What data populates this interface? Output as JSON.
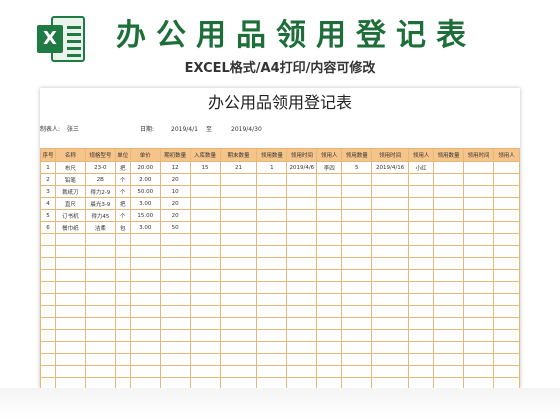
{
  "header": {
    "title": "办公用品领用登记表",
    "subtitle": "EXCEL格式/A4打印/内容可修改"
  },
  "form": {
    "title": "办公用品领用登记表",
    "filler_label": "制表人:",
    "filler_value": "张三",
    "date_label": "日期:",
    "date_from": "2019/4/1",
    "date_sep": "至",
    "date_to": "2019/4/30"
  },
  "columns": [
    "序号",
    "名称",
    "规格型号",
    "单位",
    "单价",
    "期初数量",
    "入库数量",
    "期末数量",
    "领用数量",
    "领用时间",
    "领用人",
    "领用数量",
    "领用时间",
    "领用人",
    "领用数量",
    "领用时间",
    "领用人"
  ],
  "rows": [
    [
      "1",
      "布尺",
      "23-0",
      "把",
      "20.00",
      "12",
      "15",
      "21",
      "1",
      "2019/4/6",
      "李四",
      "5",
      "2019/4/16",
      "小红",
      "",
      "",
      ""
    ],
    [
      "2",
      "铅笔",
      "2B",
      "个",
      "2.00",
      "20",
      "",
      "",
      "",
      "",
      "",
      "",
      "",
      "",
      "",
      "",
      ""
    ],
    [
      "3",
      "裁纸刀",
      "得力2-9",
      "个",
      "50.00",
      "10",
      "",
      "",
      "",
      "",
      "",
      "",
      "",
      "",
      "",
      "",
      ""
    ],
    [
      "4",
      "直尺",
      "晨光3-9",
      "把",
      "3.00",
      "20",
      "",
      "",
      "",
      "",
      "",
      "",
      "",
      "",
      "",
      "",
      ""
    ],
    [
      "5",
      "订书机",
      "得力45",
      "个",
      "15.00",
      "20",
      "",
      "",
      "",
      "",
      "",
      "",
      "",
      "",
      "",
      "",
      ""
    ],
    [
      "6",
      "餐巾纸",
      "洁柔",
      "包",
      "3.00",
      "50",
      "",
      "",
      "",
      "",
      "",
      "",
      "",
      "",
      "",
      "",
      ""
    ]
  ],
  "empty_rows": 15,
  "colors": {
    "brand_green": "#1e6e3a",
    "header_orange": "#f6c48a",
    "grid_border": "#e2b978",
    "divider_pink": "#ef8ba0"
  }
}
